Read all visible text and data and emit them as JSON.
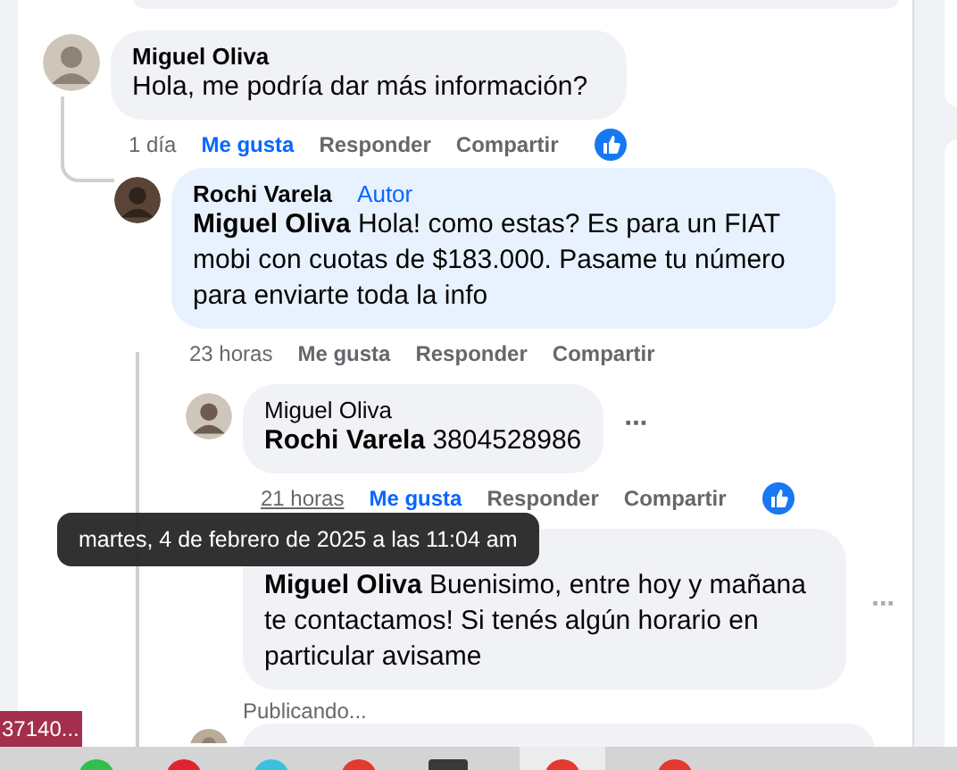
{
  "comments": [
    {
      "author": "Miguel Oliva",
      "text": "Hola, me podría dar más información?",
      "time": "1 día",
      "hovered": false,
      "like": {
        "label": "Me gusta",
        "selected": true
      },
      "reply": "Responder",
      "share": "Compartir",
      "reaction": true,
      "color": "#cfc6bb",
      "children": [
        {
          "author": "Rochi Varela",
          "badge": "Autor",
          "text": "**Miguel Oliva** Hola! como estas? Es para un FIAT mobi con cuotas de $183.000. Pasame tu número para enviarte toda la info",
          "time": "23 horas",
          "hovered": false,
          "like": {
            "label": "Me gusta",
            "selected": false
          },
          "reply": "Responder",
          "share": "Compartir",
          "color": "#5a4436",
          "children": [
            {
              "kind": "comment",
              "author": "Miguel Oliva",
              "text": "**Rochi Varela** 3804528986",
              "time": "21 horas",
              "hovered": true,
              "like": {
                "label": "Me gusta",
                "selected": true
              },
              "reply": "Responder",
              "share": "Compartir",
              "reaction": true,
              "more": "···",
              "color": "#cfc6bb"
            },
            {
              "kind": "comment",
              "text": "**Miguel Oliva** Buenisimo, entre hoy y mañana te contactamos! Si tenés algún horario en particular avisame",
              "status": "Publicando...",
              "more": "···"
            },
            {
              "kind": "partial",
              "color": "#b9ab98"
            }
          ]
        }
      ]
    }
  ],
  "tooltip": "martes, 4 de febrero de 2025 a las 11:04 am",
  "tag": "37140..."
}
